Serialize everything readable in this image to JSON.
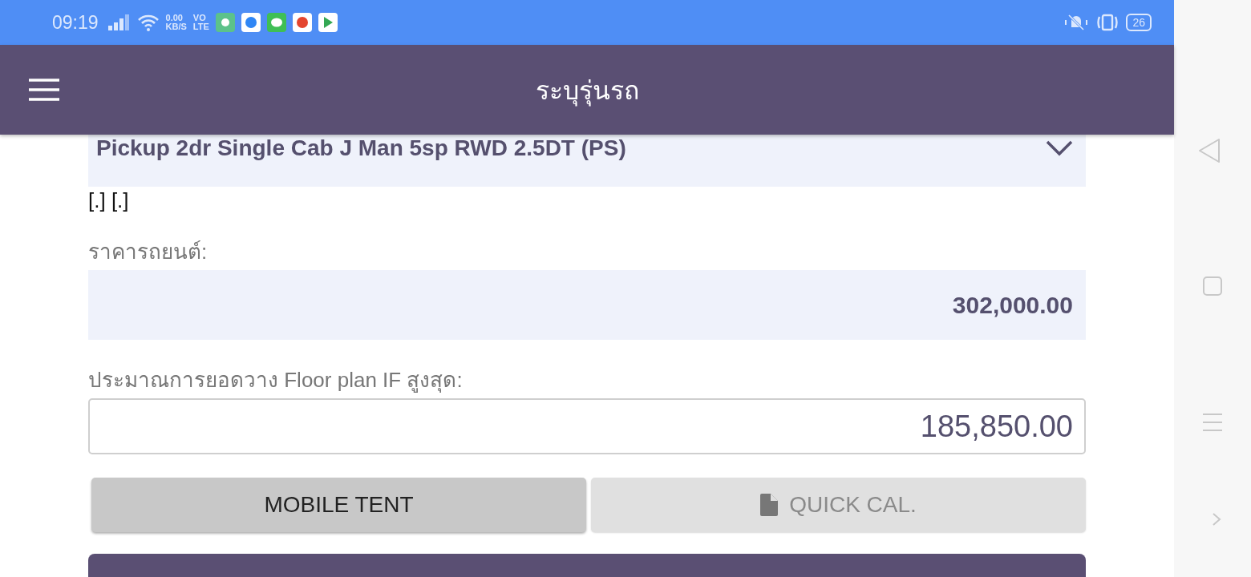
{
  "status_bar": {
    "time": "09:19",
    "speed_value": "0.00",
    "speed_unit": "KB/S",
    "network_top": "VO",
    "network_bottom": "LTE",
    "battery": "26",
    "app_icons": [
      {
        "color": "#5cc28a"
      },
      {
        "color": "#ffffff"
      },
      {
        "color": "#3fbf55"
      },
      {
        "color": "#ffffff"
      },
      {
        "color": "#ffffff"
      }
    ]
  },
  "app_bar": {
    "title": "ระบุรุ่นรถ"
  },
  "model_select": {
    "value": "Pickup 2dr Single Cab J Man 5sp RWD 2.5DT (PS)"
  },
  "note": "[.] [.]",
  "price": {
    "label": "ราคารถยนต์:",
    "value": "302,000.00"
  },
  "floor_plan": {
    "label": "ประมาณการยอดวาง Floor plan IF สูงสุด:",
    "value": "185,850.00"
  },
  "buttons": [
    {
      "label": "MOBILE TENT",
      "kind": "plain",
      "disabled": false
    },
    {
      "label": "QUICK CAL.",
      "kind": "file",
      "disabled": true
    }
  ]
}
